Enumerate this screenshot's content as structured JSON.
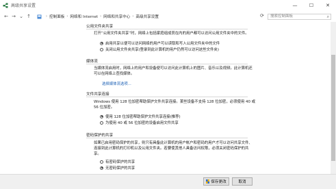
{
  "window": {
    "title": "高级共享设置",
    "minimize": "—",
    "maximize": "☐",
    "close": "✕"
  },
  "address": {
    "back": "←",
    "forward": "→",
    "recent": "⌄",
    "up": "↑",
    "crumbs": [
      "控制面板",
      "网络和 Internet",
      "网络和共享中心",
      "高级共享设置"
    ],
    "refresh": "⟳",
    "search_placeholder": "搜索控制面板"
  },
  "sections": {
    "public_folder": {
      "title": "公用文件夹共享",
      "desc": "打开“公用文件夹共享”时，网络上包括家庭组成员在内的用户都可以访问公用文件夹中的文件。",
      "options": [
        {
          "label": "启用共享以便可以访问网络的用户可以读取和写入公用文件夹中的文件",
          "selected": true
        },
        {
          "label": "关闭公用文件夹共享(登录到此计算机的用户仍然可以访问这些文件夹)",
          "selected": false
        }
      ]
    },
    "media": {
      "title": "媒体流",
      "desc_line1": "当媒体流启用时，网络上的用户和设备便可以访问此计算机上的图片、音乐以及视频。此计算机还",
      "desc_line2": "可以在网络上查找媒体。",
      "link": "选择媒体流选项..."
    },
    "file_sharing": {
      "title": "文件共享连接",
      "desc_line1": "Windows 使用 128 位加密帮助保护文件共享连接。某些设备不支持 128 位加密，必须使用 40 或",
      "desc_line2": "56 位加密。",
      "options": [
        {
          "label": "使用 128 位加密帮助保护文件共享连接(推荐)",
          "selected": true
        },
        {
          "label": "为使用 40 或 56 位加密的设备启用文件共享",
          "selected": false
        }
      ]
    },
    "password": {
      "title": "密码保护的共享",
      "desc_line1": "如果已启用密码保护的共享，则只有具备此计算机的用户帐户和密码的用户才可以访问共享文件、",
      "desc_line2": "连接到此计算机的打印机以及公用文件夹。若要使其他人具备访问权限，必须关闭密码保护的共",
      "desc_line3": "享。",
      "options": [
        {
          "label": "有密码保护的共享",
          "selected": false
        },
        {
          "label": "无密码保护的共享",
          "selected": true
        }
      ]
    }
  },
  "footer": {
    "save": "保存更改",
    "cancel": "取消"
  },
  "colors": {
    "accent": "#1a5fb4",
    "title_icon": "#2d7d46"
  }
}
